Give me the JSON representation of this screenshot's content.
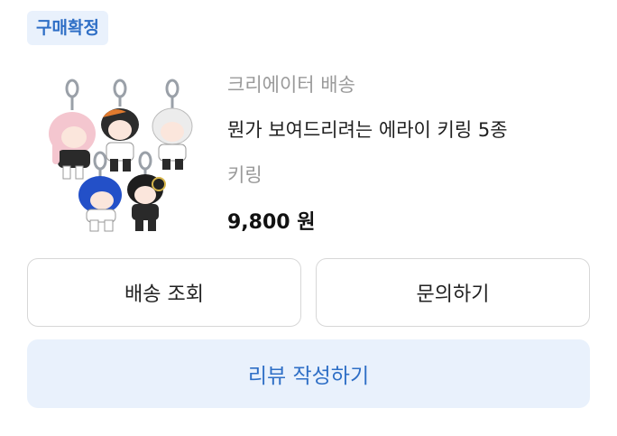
{
  "status_badge": "구매확정",
  "product": {
    "seller": "크리에이터 배송",
    "title": "뭔가 보여드리려는 에라이 키링 5종",
    "option": "키링",
    "price": "9,800 원",
    "thumbnail_icon": "keychain-product-image"
  },
  "buttons": {
    "track": "배송 조회",
    "inquiry": "문의하기",
    "review": "리뷰 작성하기"
  },
  "colors": {
    "accent": "#2f6fc6",
    "accent_bg": "#e9f1fc",
    "muted_text": "#9a9a9a",
    "border": "#d7d7d7"
  }
}
